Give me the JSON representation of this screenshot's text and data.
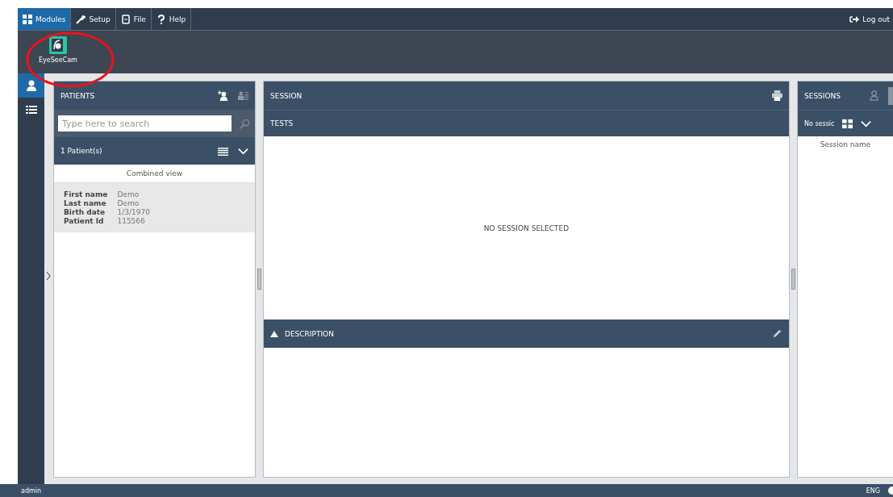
{
  "menu": [
    {
      "label": "Modules",
      "kind": "modules",
      "selected": true
    },
    {
      "label": "Setup",
      "kind": "setup",
      "selected": false
    },
    {
      "label": "File",
      "kind": "file",
      "selected": false
    },
    {
      "label": "Help",
      "kind": "help",
      "selected": false
    }
  ],
  "logout": "Log out",
  "modules": [
    {
      "label": "EyeSeeCam"
    }
  ],
  "nav": [
    {
      "kind": "person",
      "selected": true
    },
    {
      "kind": "list",
      "selected": false
    }
  ],
  "patients": {
    "title": "PATIENTS",
    "search": {
      "placeholder": "Type here to search"
    },
    "count": "1 Patient(s)",
    "view": "Combined view",
    "fields": [
      {
        "label": "First name",
        "value": "Demo"
      },
      {
        "label": "Last name",
        "value": "Demo"
      },
      {
        "label": "Birth date",
        "value": "1/3/1970"
      },
      {
        "label": "Patient Id",
        "value": "115566"
      }
    ]
  },
  "session": {
    "title": "SESSION",
    "tests": "TESTS",
    "empty": "NO SESSION SELECTED",
    "description": "DESCRIPTION"
  },
  "sessions": {
    "title": "SESSIONS",
    "filter": "No sessic",
    "column": "Session name"
  },
  "status": {
    "user": "admin",
    "lang": "ENG"
  }
}
